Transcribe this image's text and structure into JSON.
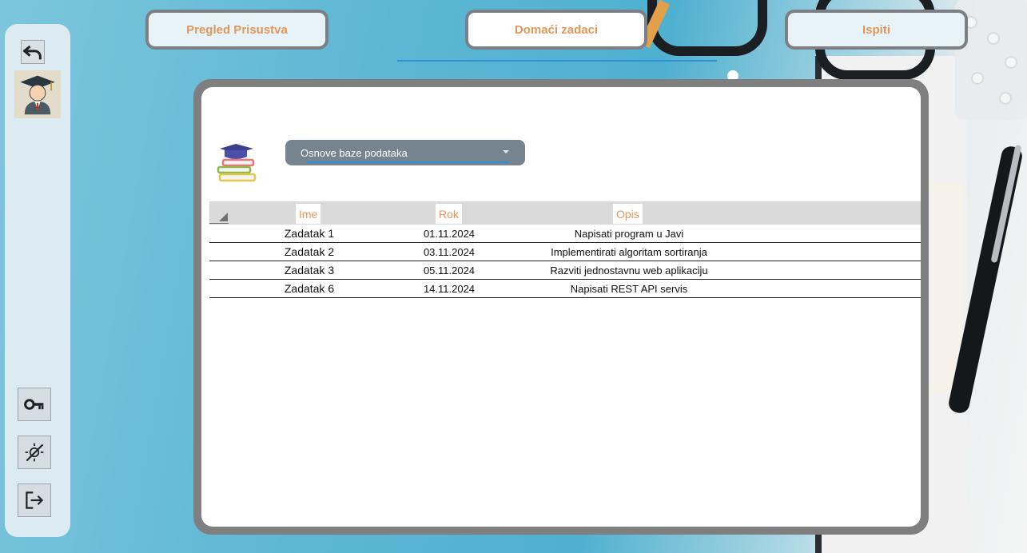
{
  "tabs": [
    {
      "label": "Pregled Prisustva",
      "active": false
    },
    {
      "label": "Domaći zadaci",
      "active": true
    },
    {
      "label": "Ispiti",
      "active": false
    }
  ],
  "sidebar": {
    "top_icons": [
      "undo-icon",
      "student-avatar"
    ],
    "bottom_icons": [
      "key-icon",
      "theme-toggle-icon",
      "logout-icon"
    ]
  },
  "course_select": {
    "value": "Osnove baze podataka"
  },
  "table": {
    "columns": [
      "Ime",
      "Rok",
      "Opis"
    ],
    "rows": [
      {
        "ime": "Zadatak 1",
        "rok": "01.11.2024",
        "opis": "Napisati program u Javi"
      },
      {
        "ime": "Zadatak 2",
        "rok": "03.11.2024",
        "opis": "Implementirati algoritam sortiranja"
      },
      {
        "ime": "Zadatak 3",
        "rok": "05.11.2024",
        "opis": "Razviti jednostavnu web aplikaciju"
      },
      {
        "ime": "Zadatak 6",
        "rok": "14.11.2024",
        "opis": "Napisati REST API servis"
      }
    ]
  },
  "colors": {
    "accent_orange": "#e0975c",
    "panel_frame": "#7f7f7f",
    "dropdown_bg": "#75848f",
    "underline_blue": "#2f8fd8"
  }
}
